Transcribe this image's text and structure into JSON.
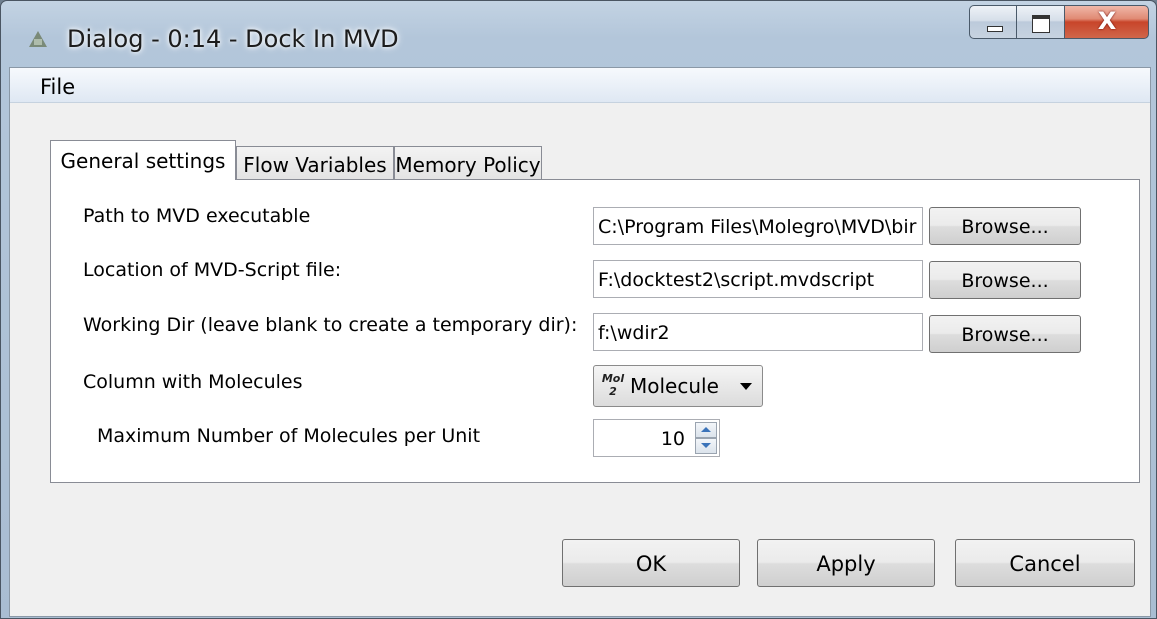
{
  "window": {
    "title": "Dialog - 0:14 - Dock In MVD",
    "close_glyph": "X"
  },
  "menubar": {
    "file_label": "File"
  },
  "tabs": [
    {
      "label": "General settings"
    },
    {
      "label": "Flow Variables"
    },
    {
      "label": "Memory Policy"
    }
  ],
  "settings": {
    "mvd_exec_label": "Path to MVD executable",
    "mvd_exec_value": "C:\\Program Files\\Molegro\\MVD\\bir",
    "script_label": "Location of MVD-Script file:",
    "script_value": "F:\\docktest2\\script.mvdscript",
    "workdir_label": "Working Dir (leave blank to create a temporary dir):",
    "workdir_value": "f:\\wdir2",
    "browse_label": "Browse...",
    "column_label": "Column with Molecules",
    "column_icon_top": "Mol",
    "column_icon_bottom": "2",
    "column_value": "Molecule",
    "max_label": "Maximum Number of Molecules per Unit",
    "max_value": "10"
  },
  "buttons": {
    "ok": "OK",
    "apply": "Apply",
    "cancel": "Cancel"
  },
  "icons": {
    "app": "app-icon",
    "minimize": "minimize-icon",
    "maximize": "maximize-icon",
    "close": "close-icon",
    "molecule_type": "molecule-type-icon",
    "dropdown": "chevron-down-icon",
    "spin_up": "spin-up-icon",
    "spin_down": "spin-down-icon"
  }
}
